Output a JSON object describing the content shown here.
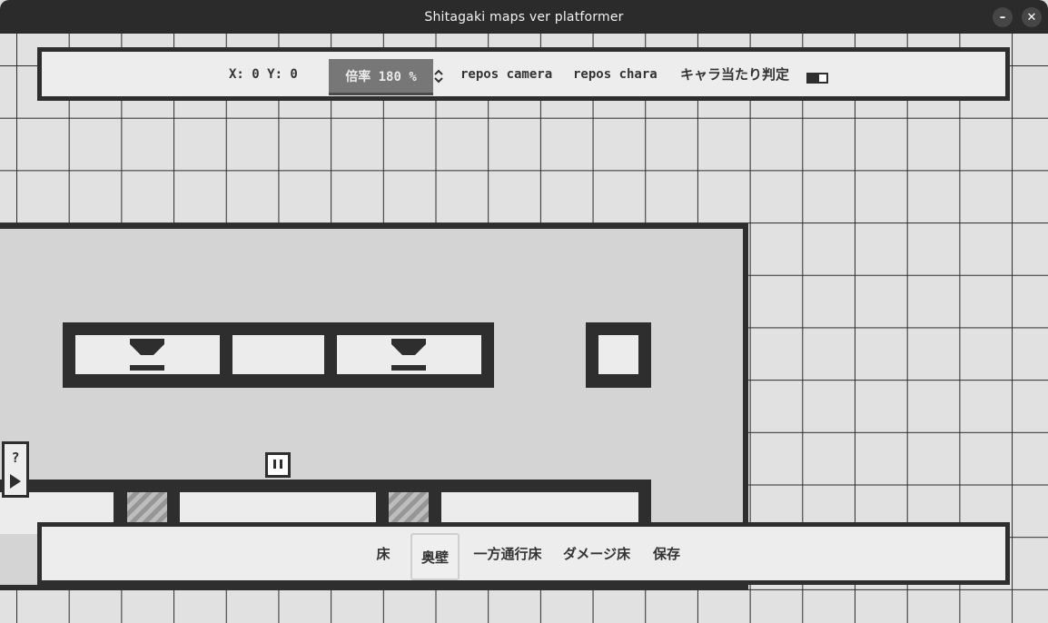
{
  "window": {
    "title": "Shitagaki maps ver platformer",
    "minimize_icon": "minus-icon",
    "close_icon": "close-icon"
  },
  "top_bar": {
    "coords": "X: 0 Y: 0",
    "zoom_label": "倍率 180 %",
    "zoom_icon": "up-down-chevron-icon",
    "repos_camera": "repos camera",
    "repos_chara": "repos chara",
    "collision_label": "キャラ当たり判定",
    "collision_enabled": false
  },
  "bottom_bar": {
    "tools": [
      "床",
      "奥壁",
      "一方通行床",
      "ダメージ床",
      "保存"
    ],
    "selected_tool": "奥壁"
  },
  "help": {
    "question": "?",
    "play_icon": "play-icon"
  },
  "colors": {
    "wall": "#2e2e2e",
    "room_fill": "#d4d4d4",
    "grid_bg": "#e1e1e1",
    "panel_fill": "#ededed",
    "zoom_bg": "#777777"
  }
}
